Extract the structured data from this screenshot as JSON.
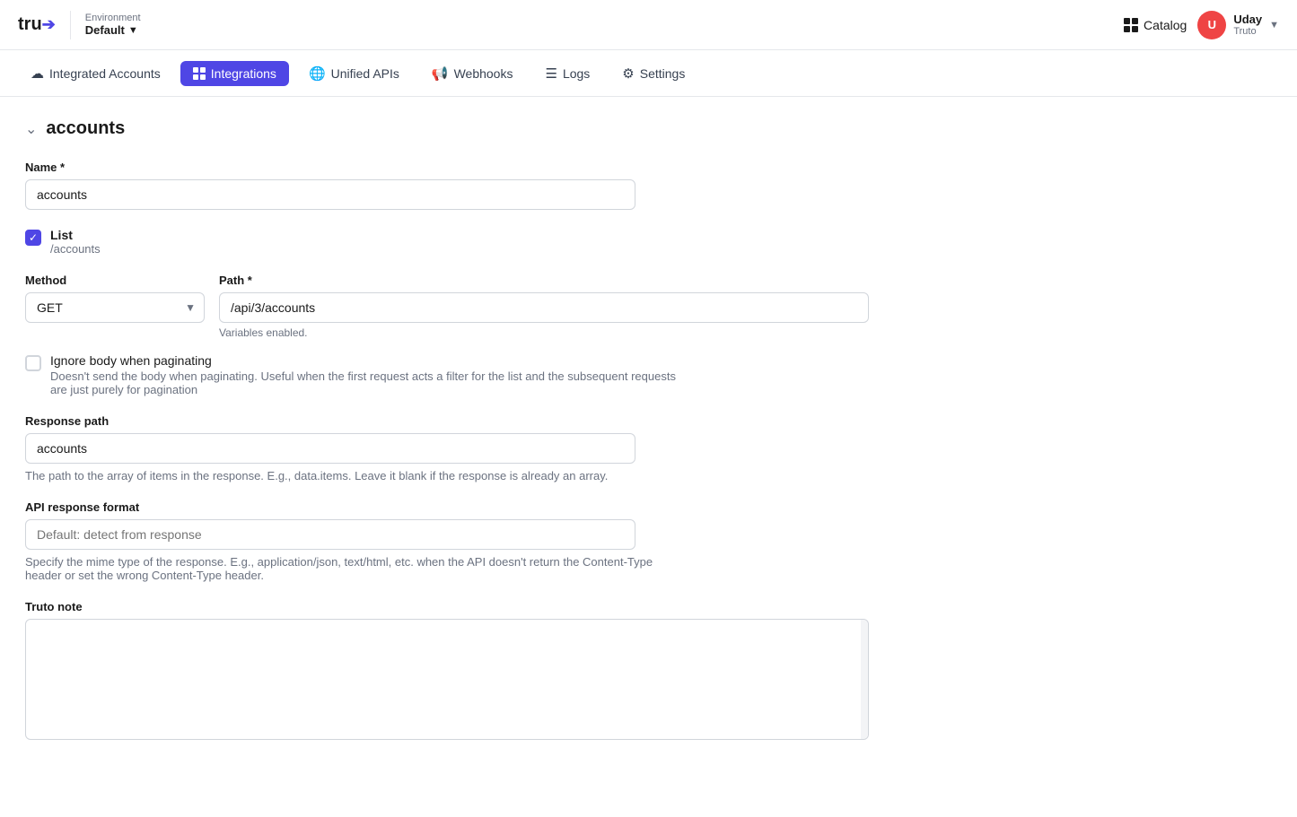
{
  "topbar": {
    "logo": "tru",
    "logo_arrow": "→",
    "env_label": "Environment",
    "env_value": "Default",
    "catalog_label": "Catalog",
    "user_initial": "U",
    "user_name": "Uday",
    "user_org": "Truto"
  },
  "secnav": {
    "items": [
      {
        "id": "integrated-accounts",
        "label": "Integrated Accounts",
        "icon": "cloud"
      },
      {
        "id": "integrations",
        "label": "Integrations",
        "icon": "grid",
        "active": true
      },
      {
        "id": "unified-apis",
        "label": "Unified APIs",
        "icon": "globe"
      },
      {
        "id": "webhooks",
        "label": "Webhooks",
        "icon": "megaphone"
      },
      {
        "id": "logs",
        "label": "Logs",
        "icon": "list"
      },
      {
        "id": "settings",
        "label": "Settings",
        "icon": "gear"
      }
    ]
  },
  "page": {
    "title": "accounts",
    "form": {
      "name_label": "Name *",
      "name_value": "accounts",
      "list_label": "List",
      "list_path": "/accounts",
      "method_label": "Method",
      "method_value": "GET",
      "path_label": "Path *",
      "path_value": "/api/3/accounts",
      "variables_hint": "Variables enabled.",
      "ignore_body_label": "Ignore body when paginating",
      "ignore_body_desc": "Doesn't send the body when paginating. Useful when the first request acts a filter for the list and the subsequent requests are just purely for pagination",
      "response_path_label": "Response path",
      "response_path_value": "accounts",
      "response_path_desc": "The path to the array of items in the response. E.g., data.items. Leave it blank if the response is already an array.",
      "api_format_label": "API response format",
      "api_format_placeholder": "Default: detect from response",
      "api_format_desc": "Specify the mime type of the response. E.g., application/json, text/html, etc. when the API doesn't return the Content-Type header or set the wrong Content-Type header.",
      "truto_note_label": "Truto note"
    }
  }
}
